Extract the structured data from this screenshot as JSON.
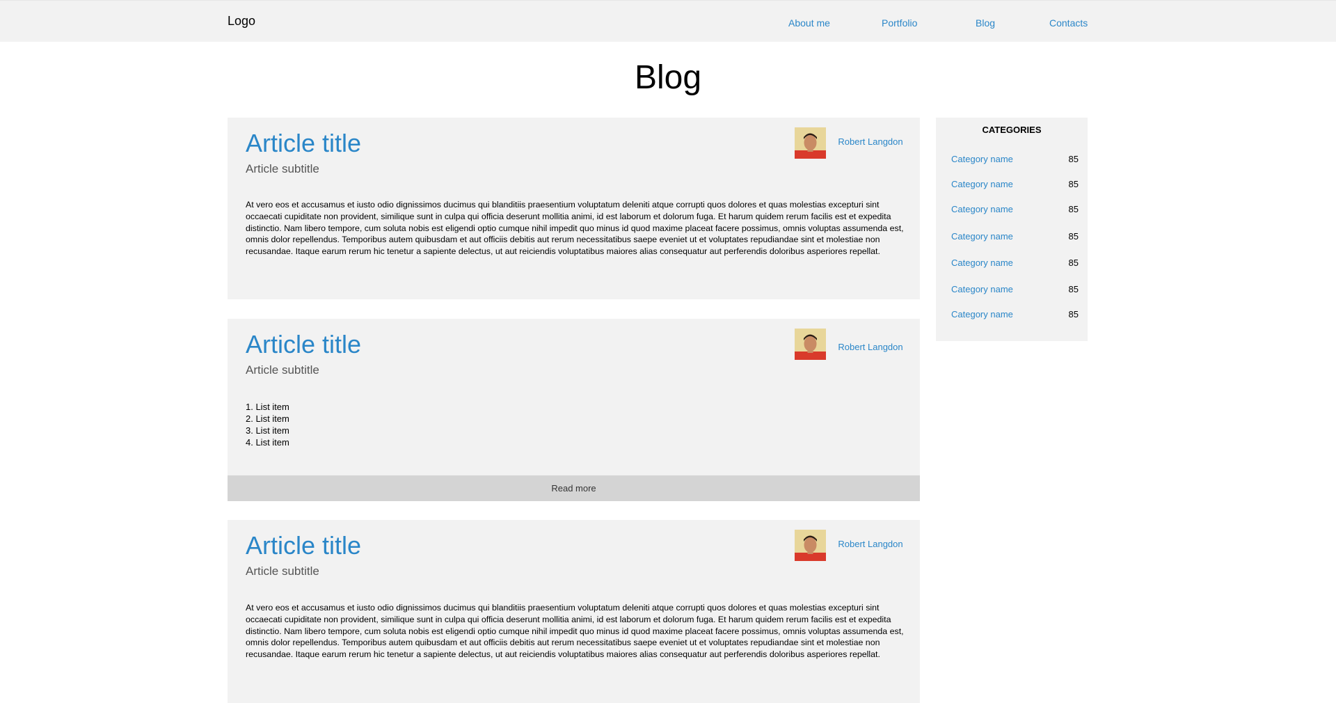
{
  "header": {
    "logo": "Logo",
    "nav": [
      "About me",
      "Portfolio",
      "Blog",
      "Contacts"
    ]
  },
  "page": {
    "title": "Blog"
  },
  "articles": [
    {
      "title": "Article title",
      "subtitle": "Article subtitle",
      "author": "Robert Langdon",
      "body": "At vero eos et accusamus et iusto odio dignissimos ducimus qui blanditiis praesentium voluptatum deleniti atque corrupti quos dolores et quas molestias excepturi sint occaecati cupiditate non provident, similique sunt in culpa qui officia deserunt mollitia animi, id est laborum et dolorum fuga. Et harum quidem rerum facilis est et expedita distinctio. Nam libero tempore, cum soluta nobis est eligendi optio cumque nihil impedit quo minus id quod maxime placeat facere possimus, omnis voluptas assumenda est, omnis dolor repellendus. Temporibus autem quibusdam et aut officiis debitis aut rerum necessitatibus saepe eveniet ut et voluptates repudiandae sint et molestiae non recusandae. Itaque earum rerum hic tenetur a sapiente delectus, ut aut reiciendis voluptatibus maiores alias consequatur aut perferendis doloribus asperiores repellat."
    },
    {
      "title": "Article title",
      "subtitle": "Article subtitle",
      "author": "Robert Langdon",
      "list": [
        "1. List item",
        "2. List item",
        "3. List item",
        "4. List item"
      ],
      "read_more": "Read more"
    },
    {
      "title": "Article title",
      "subtitle": "Article subtitle",
      "author": "Robert Langdon",
      "body": "At vero eos et accusamus et iusto odio dignissimos ducimus qui blanditiis praesentium voluptatum deleniti atque corrupti quos dolores et quas molestias excepturi sint occaecati cupiditate non provident, similique sunt in culpa qui officia deserunt mollitia animi, id est laborum et dolorum fuga. Et harum quidem rerum facilis est et expedita distinctio. Nam libero tempore, cum soluta nobis est eligendi optio cumque nihil impedit quo minus id quod maxime placeat facere possimus, omnis voluptas assumenda est, omnis dolor repellendus. Temporibus autem quibusdam et aut officiis debitis aut rerum necessitatibus saepe eveniet ut et voluptates repudiandae sint et molestiae non recusandae. Itaque earum rerum hic tenetur a sapiente delectus, ut aut reiciendis voluptatibus maiores alias consequatur aut perferendis doloribus asperiores repellat."
    }
  ],
  "sidebar": {
    "heading": "CATEGORIES",
    "categories": [
      {
        "name": "Category name",
        "count": "85"
      },
      {
        "name": "Category name",
        "count": "85"
      },
      {
        "name": "Category name",
        "count": "85"
      },
      {
        "name": "Category name",
        "count": "85"
      },
      {
        "name": "Category name",
        "count": "85"
      },
      {
        "name": "Category name",
        "count": "85"
      },
      {
        "name": "Category name",
        "count": "85"
      }
    ]
  },
  "colors": {
    "link": "#2a86c8",
    "panel": "#f2f2f2",
    "read_more_bg": "#d4d4d4"
  }
}
